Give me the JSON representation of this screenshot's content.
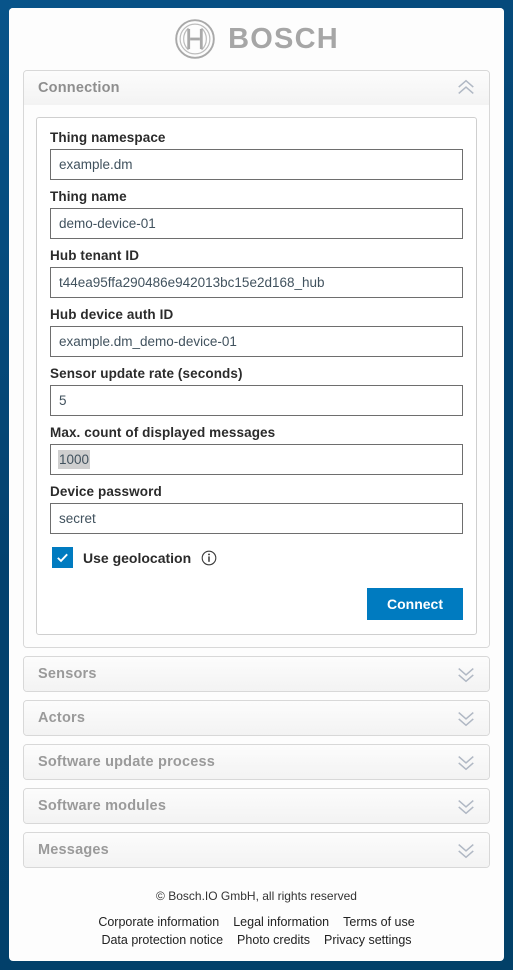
{
  "brand": {
    "logo_icon": "bosch-logo-icon",
    "wordmark": "BOSCH"
  },
  "sections": [
    {
      "id": "connection",
      "title": "Connection",
      "expanded": true,
      "toggle_icon": "chevron-double-up-icon"
    },
    {
      "id": "sensors",
      "title": "Sensors",
      "expanded": false,
      "toggle_icon": "chevron-double-down-icon"
    },
    {
      "id": "actors",
      "title": "Actors",
      "expanded": false,
      "toggle_icon": "chevron-double-down-icon"
    },
    {
      "id": "software-update-process",
      "title": "Software update process",
      "expanded": false,
      "toggle_icon": "chevron-double-down-icon"
    },
    {
      "id": "software-modules",
      "title": "Software modules",
      "expanded": false,
      "toggle_icon": "chevron-double-down-icon"
    },
    {
      "id": "messages",
      "title": "Messages",
      "expanded": false,
      "toggle_icon": "chevron-double-down-icon"
    }
  ],
  "connection_form": {
    "fields": [
      {
        "id": "thing-namespace",
        "label": "Thing namespace",
        "value": "example.dm"
      },
      {
        "id": "thing-name",
        "label": "Thing name",
        "value": "demo-device-01"
      },
      {
        "id": "hub-tenant-id",
        "label": "Hub tenant ID",
        "value": "t44ea95ffa290486e942013bc15e2d168_hub"
      },
      {
        "id": "hub-device-auth-id",
        "label": "Hub device auth ID",
        "value": "example.dm_demo-device-01"
      },
      {
        "id": "sensor-update-rate",
        "label": "Sensor update rate (seconds)",
        "value": "5"
      },
      {
        "id": "max-messages",
        "label": "Max. count of displayed messages",
        "value": "1000",
        "text_selected": true
      },
      {
        "id": "device-password",
        "label": "Device password",
        "value": "secret"
      }
    ],
    "geolocation": {
      "label": "Use geolocation",
      "checked": true,
      "check_icon": "checkmark-icon",
      "info_icon": "info-circle-icon"
    },
    "connect_label": "Connect"
  },
  "footer": {
    "copyright": "© Bosch.IO GmbH, all rights reserved",
    "links": [
      "Corporate information",
      "Legal information",
      "Terms of use",
      "Data protection notice",
      "Photo credits",
      "Privacy settings"
    ]
  },
  "colors": {
    "bosch_blue": "#007bc0",
    "frame_blue": "#03416e",
    "label_text": "#2b2b2b",
    "value_text": "#41525e",
    "panel_title": "#9a9a9a",
    "selection_gray": "#cfcfcf"
  }
}
